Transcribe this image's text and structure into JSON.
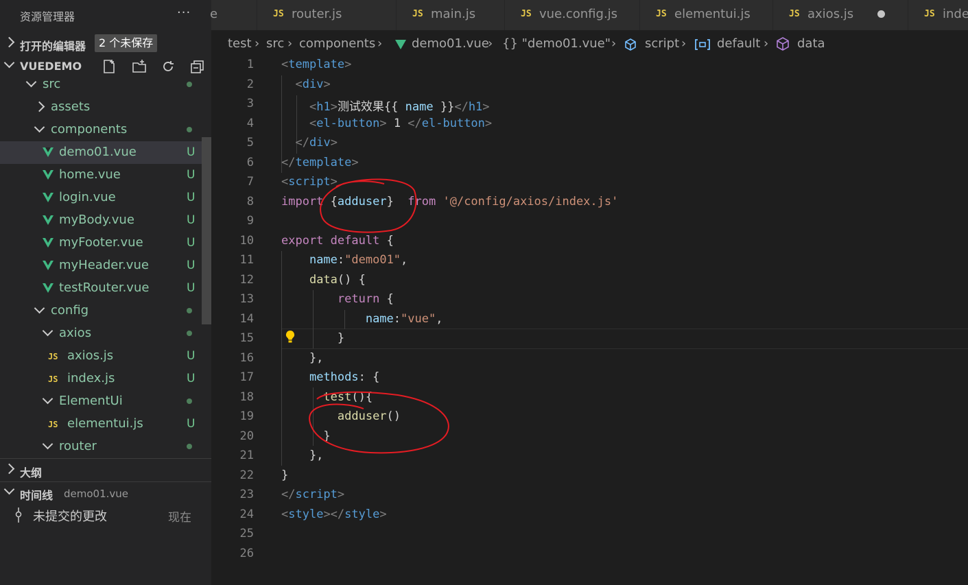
{
  "sidebar": {
    "title": "资源管理器",
    "more": "···",
    "open_editors": {
      "label": "打开的编辑器",
      "badge": "2 个未保存"
    },
    "project": {
      "label": "VUEDEMO"
    },
    "tree": [
      {
        "name": "src",
        "type": "folder",
        "expanded": true,
        "indent": 1,
        "status": "dot"
      },
      {
        "name": "assets",
        "type": "folder",
        "expanded": false,
        "indent": 2,
        "status": ""
      },
      {
        "name": "components",
        "type": "folder",
        "expanded": true,
        "indent": 2,
        "status": "dot"
      },
      {
        "name": "demo01.vue",
        "type": "vue",
        "indent": 3,
        "status": "U",
        "selected": true
      },
      {
        "name": "home.vue",
        "type": "vue",
        "indent": 3,
        "status": "U"
      },
      {
        "name": "login.vue",
        "type": "vue",
        "indent": 3,
        "status": "U"
      },
      {
        "name": "myBody.vue",
        "type": "vue",
        "indent": 3,
        "status": "U"
      },
      {
        "name": "myFooter.vue",
        "type": "vue",
        "indent": 3,
        "status": "U"
      },
      {
        "name": "myHeader.vue",
        "type": "vue",
        "indent": 3,
        "status": "U"
      },
      {
        "name": "testRouter.vue",
        "type": "vue",
        "indent": 3,
        "status": "U"
      },
      {
        "name": "config",
        "type": "folder",
        "expanded": true,
        "indent": 2,
        "status": "dot"
      },
      {
        "name": "axios",
        "type": "folder",
        "expanded": true,
        "indent": 3,
        "status": "dot"
      },
      {
        "name": "axios.js",
        "type": "js",
        "indent": 4,
        "status": "U"
      },
      {
        "name": "index.js",
        "type": "js",
        "indent": 4,
        "status": "U"
      },
      {
        "name": "ElementUi",
        "type": "folder",
        "expanded": true,
        "indent": 3,
        "status": "dot"
      },
      {
        "name": "elementui.js",
        "type": "js",
        "indent": 4,
        "status": "U"
      },
      {
        "name": "router",
        "type": "folder",
        "expanded": true,
        "indent": 3,
        "status": "dot"
      }
    ],
    "outline": {
      "label": "大纲"
    },
    "timeline": {
      "label": "时间线",
      "file": "demo01.vue",
      "entry": "未提交的更改",
      "time": "现在"
    }
  },
  "tabs": [
    {
      "label": "e",
      "icon": ""
    },
    {
      "label": "router.js",
      "icon": "JS"
    },
    {
      "label": "main.js",
      "icon": "JS"
    },
    {
      "label": "vue.config.js",
      "icon": "JS"
    },
    {
      "label": "elementui.js",
      "icon": "JS"
    },
    {
      "label": "axios.js",
      "icon": "JS",
      "modified": true
    },
    {
      "label": "index.js",
      "icon": "JS"
    }
  ],
  "breadcrumb": [
    "test",
    "src",
    "components",
    "demo01.vue",
    "{} \"demo01.vue\"",
    "script",
    "default",
    "data"
  ],
  "code": {
    "line_numbers": [
      "1",
      "2",
      "3",
      "4",
      "5",
      "6",
      "7",
      "8",
      "9",
      "10",
      "11",
      "12",
      "13",
      "14",
      "15",
      "16",
      "17",
      "18",
      "19",
      "20",
      "21",
      "22",
      "23",
      "24",
      "25",
      "26"
    ],
    "lines": [
      [
        [
          "t-br",
          "<"
        ],
        [
          "t-tag",
          "template"
        ],
        [
          "t-br",
          ">"
        ]
      ],
      [
        [
          "t-def",
          "  "
        ],
        [
          "t-br",
          "<"
        ],
        [
          "t-tag",
          "div"
        ],
        [
          "t-br",
          ">"
        ]
      ],
      [
        [
          "t-def",
          "    "
        ],
        [
          "t-br",
          "<"
        ],
        [
          "t-tag",
          "h1"
        ],
        [
          "t-br",
          ">"
        ],
        [
          "t-def",
          "测试效果{{ "
        ],
        [
          "t-bind",
          "name"
        ],
        [
          "t-def",
          " }}"
        ],
        [
          "t-br",
          "</"
        ],
        [
          "t-tag",
          "h1"
        ],
        [
          "t-br",
          ">"
        ]
      ],
      [
        [
          "t-def",
          "    "
        ],
        [
          "t-br",
          "<"
        ],
        [
          "t-tag",
          "el-button"
        ],
        [
          "t-br",
          ">"
        ],
        [
          "t-def",
          " 1 "
        ],
        [
          "t-br",
          "</"
        ],
        [
          "t-tag",
          "el-button"
        ],
        [
          "t-br",
          ">"
        ]
      ],
      [
        [
          "t-def",
          "  "
        ],
        [
          "t-br",
          "</"
        ],
        [
          "t-tag",
          "div"
        ],
        [
          "t-br",
          ">"
        ]
      ],
      [
        [
          "t-br",
          "</"
        ],
        [
          "t-tag",
          "template"
        ],
        [
          "t-br",
          ">"
        ]
      ],
      [
        [
          "t-br",
          "<"
        ],
        [
          "t-tag",
          "script"
        ],
        [
          "t-br",
          ">"
        ]
      ],
      [
        [
          "t-kw",
          "import"
        ],
        [
          "t-def",
          " {"
        ],
        [
          "t-attr",
          "adduser"
        ],
        [
          "t-def",
          "}  "
        ],
        [
          "t-kw",
          "from"
        ],
        [
          "t-def",
          " "
        ],
        [
          "t-str",
          "'@/config/axios/index.js'"
        ]
      ],
      [],
      [
        [
          "t-kw",
          "export"
        ],
        [
          "t-def",
          " "
        ],
        [
          "t-kw",
          "default"
        ],
        [
          "t-def",
          " {"
        ]
      ],
      [
        [
          "t-def",
          "    "
        ],
        [
          "t-attr",
          "name"
        ],
        [
          "t-def",
          ":"
        ],
        [
          "t-str",
          "\"demo01\""
        ],
        [
          "t-def",
          ","
        ]
      ],
      [
        [
          "t-def",
          "    "
        ],
        [
          "t-fn",
          "data"
        ],
        [
          "t-def",
          "() {"
        ]
      ],
      [
        [
          "t-def",
          "        "
        ],
        [
          "t-kw",
          "return"
        ],
        [
          "t-def",
          " {"
        ]
      ],
      [
        [
          "t-def",
          "            "
        ],
        [
          "t-attr",
          "name"
        ],
        [
          "t-def",
          ":"
        ],
        [
          "t-str",
          "\"vue\""
        ],
        [
          "t-def",
          ","
        ]
      ],
      [
        [
          "t-def",
          "        }"
        ]
      ],
      [
        [
          "t-def",
          "    },"
        ]
      ],
      [
        [
          "t-def",
          "    "
        ],
        [
          "t-attr",
          "methods"
        ],
        [
          "t-def",
          ": {"
        ]
      ],
      [
        [
          "t-def",
          "      "
        ],
        [
          "t-fn",
          "test"
        ],
        [
          "t-def",
          "(){"
        ]
      ],
      [
        [
          "t-def",
          "        "
        ],
        [
          "t-fn",
          "adduser"
        ],
        [
          "t-def",
          "()"
        ]
      ],
      [
        [
          "t-def",
          "      }"
        ]
      ],
      [
        [
          "t-def",
          "    },"
        ]
      ],
      [
        [
          "t-def",
          "}"
        ]
      ],
      [
        [
          "t-br",
          "</"
        ],
        [
          "t-tag",
          "script"
        ],
        [
          "t-br",
          ">"
        ]
      ],
      [
        [
          "t-br",
          "<"
        ],
        [
          "t-tag",
          "style"
        ],
        [
          "t-br",
          "></"
        ],
        [
          "t-tag",
          "style"
        ],
        [
          "t-br",
          ">"
        ]
      ],
      [],
      []
    ]
  },
  "colors": {
    "annotation": "#e51c23",
    "vue_green": "#41b883",
    "js_yellow": "#e6c84a",
    "untracked": "#73c991"
  }
}
